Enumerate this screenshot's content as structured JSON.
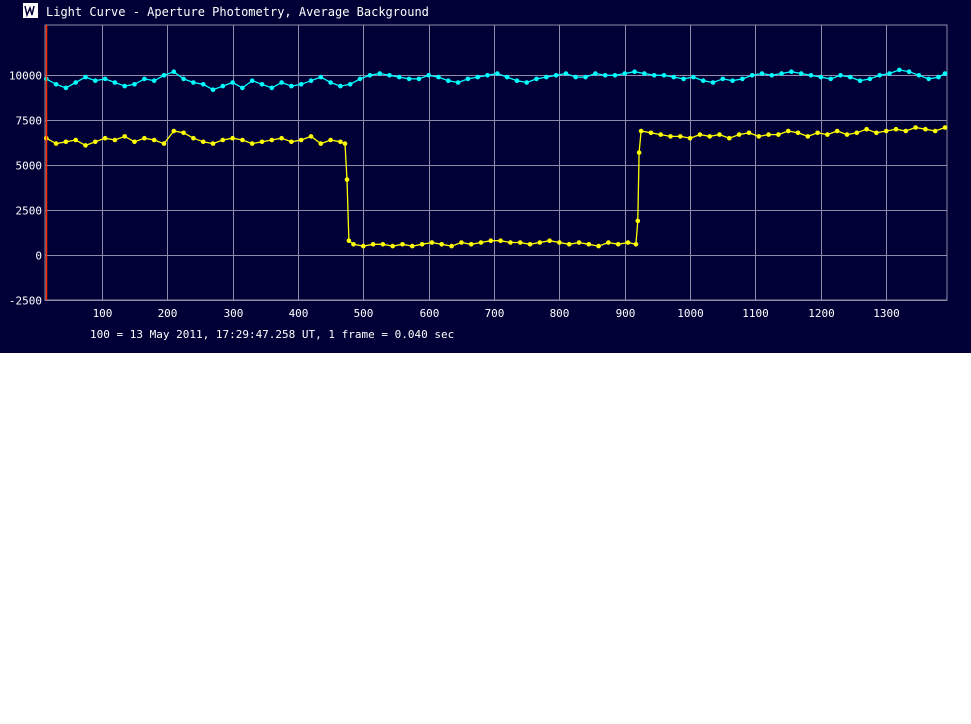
{
  "window": {
    "title": "Light Curve - Aperture Photometry, Average Background",
    "icon": "light-curve-icon"
  },
  "footer": {
    "caption": "100 = 13 May 2011, 17:29:47.258 UT, 1 frame = 0.040 sec"
  },
  "colors": {
    "background": "#000036",
    "grid": "#8c8ca8",
    "axis_text": "#ffffff",
    "series_target": "#ffff00",
    "series_comparison": "#00ffff",
    "cursor": "#ff3000"
  },
  "chart_data": {
    "type": "line",
    "title": "",
    "xlabel": "",
    "ylabel": "",
    "xlim": [
      13,
      1393
    ],
    "ylim": [
      -2500,
      12800
    ],
    "x_ticks": [
      100,
      200,
      300,
      400,
      500,
      600,
      700,
      800,
      900,
      1000,
      1100,
      1200,
      1300
    ],
    "y_ticks": [
      -2500,
      0,
      2500,
      5000,
      7500,
      10000
    ],
    "x_tick_labels": [
      "100",
      "200",
      "300",
      "400",
      "500",
      "600",
      "700",
      "800",
      "900",
      "1000",
      "1100",
      "1200",
      "1300"
    ],
    "y_tick_labels": [
      "-2500",
      "0",
      "2500",
      "5000",
      "7500",
      "10000"
    ],
    "grid": true,
    "markers": true,
    "cursor_x": 15,
    "series": [
      {
        "color": "#00ffff",
        "x": [
          15,
          30,
          45,
          60,
          75,
          90,
          105,
          120,
          135,
          150,
          165,
          180,
          195,
          210,
          225,
          240,
          255,
          270,
          285,
          300,
          315,
          330,
          345,
          360,
          375,
          390,
          405,
          420,
          435,
          450,
          465,
          480,
          495,
          510,
          525,
          540,
          555,
          570,
          585,
          600,
          615,
          630,
          645,
          660,
          675,
          690,
          705,
          720,
          735,
          750,
          765,
          780,
          795,
          810,
          825,
          840,
          855,
          870,
          885,
          900,
          915,
          930,
          945,
          960,
          975,
          990,
          1005,
          1020,
          1035,
          1050,
          1065,
          1080,
          1095,
          1110,
          1125,
          1140,
          1155,
          1170,
          1185,
          1200,
          1215,
          1230,
          1245,
          1260,
          1275,
          1290,
          1305,
          1320,
          1335,
          1350,
          1365,
          1380,
          1390
        ],
        "y": [
          9800,
          9500,
          9300,
          9600,
          9900,
          9700,
          9800,
          9600,
          9400,
          9500,
          9800,
          9700,
          10000,
          10200,
          9800,
          9600,
          9500,
          9200,
          9400,
          9600,
          9300,
          9700,
          9500,
          9300,
          9600,
          9400,
          9500,
          9700,
          9900,
          9600,
          9400,
          9500,
          9800,
          10000,
          10100,
          10000,
          9900,
          9800,
          9800,
          10000,
          9900,
          9700,
          9600,
          9800,
          9900,
          10000,
          10100,
          9900,
          9700,
          9600,
          9800,
          9900,
          10000,
          10100,
          9900,
          9900,
          10100,
          10000,
          10000,
          10100,
          10200,
          10100,
          10000,
          10000,
          9900,
          9800,
          9900,
          9700,
          9600,
          9800,
          9700,
          9800,
          10000,
          10100,
          10000,
          10100,
          10200,
          10100,
          10000,
          9900,
          9800,
          10000,
          9900,
          9700,
          9800,
          10000,
          10100,
          10300,
          10200,
          10000,
          9800,
          9900,
          10100
        ]
      },
      {
        "color": "#ffff00",
        "x": [
          15,
          30,
          45,
          60,
          75,
          90,
          105,
          120,
          135,
          150,
          165,
          180,
          195,
          210,
          225,
          240,
          255,
          270,
          285,
          300,
          315,
          330,
          345,
          360,
          375,
          390,
          405,
          420,
          435,
          450,
          465,
          472,
          475,
          478,
          485,
          500,
          515,
          530,
          545,
          560,
          575,
          590,
          605,
          620,
          635,
          650,
          665,
          680,
          695,
          710,
          725,
          740,
          755,
          770,
          785,
          800,
          815,
          830,
          845,
          860,
          875,
          890,
          905,
          917,
          920,
          922,
          925,
          940,
          955,
          970,
          985,
          1000,
          1015,
          1030,
          1045,
          1060,
          1075,
          1090,
          1105,
          1120,
          1135,
          1150,
          1165,
          1180,
          1195,
          1210,
          1225,
          1240,
          1255,
          1270,
          1285,
          1300,
          1315,
          1330,
          1345,
          1360,
          1375,
          1390
        ],
        "y": [
          6500,
          6200,
          6300,
          6400,
          6100,
          6300,
          6500,
          6400,
          6600,
          6300,
          6500,
          6400,
          6200,
          6900,
          6800,
          6500,
          6300,
          6200,
          6400,
          6500,
          6400,
          6200,
          6300,
          6400,
          6500,
          6300,
          6400,
          6600,
          6200,
          6400,
          6300,
          6200,
          4200,
          800,
          600,
          500,
          600,
          600,
          500,
          600,
          500,
          600,
          700,
          600,
          500,
          700,
          600,
          700,
          800,
          800,
          700,
          700,
          600,
          700,
          800,
          700,
          600,
          700,
          600,
          500,
          700,
          600,
          700,
          600,
          1900,
          5700,
          6900,
          6800,
          6700,
          6600,
          6600,
          6500,
          6700,
          6600,
          6700,
          6500,
          6700,
          6800,
          6600,
          6700,
          6700,
          6900,
          6800,
          6600,
          6800,
          6700,
          6900,
          6700,
          6800,
          7000,
          6800,
          6900,
          7000,
          6900,
          7100,
          7000,
          6900,
          7100
        ]
      }
    ]
  }
}
